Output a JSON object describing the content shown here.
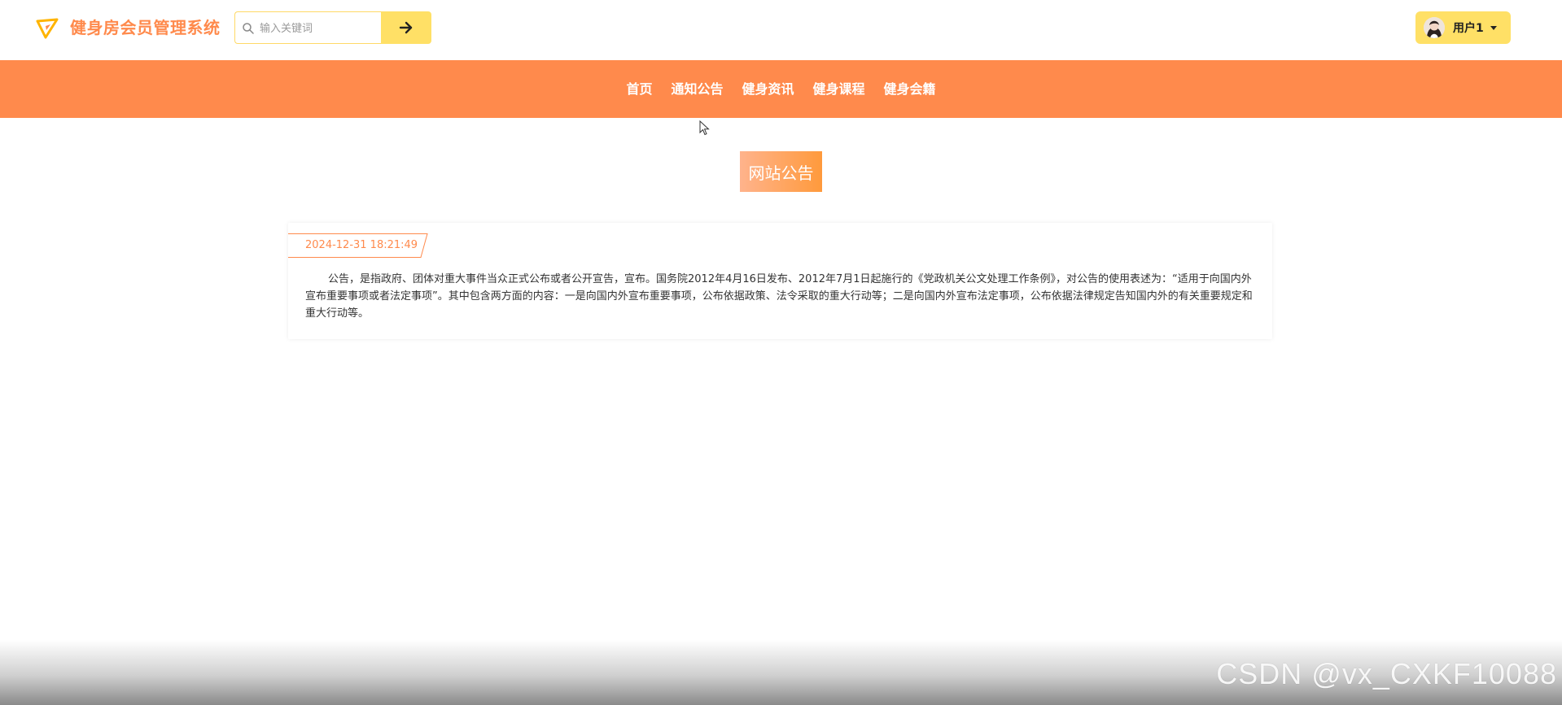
{
  "header": {
    "logo_icon": "paper-plane-icon",
    "site_title": "健身房会员管理系统",
    "search": {
      "placeholder": "输入关键词",
      "value": "",
      "search_icon": "search-icon",
      "submit_icon": "arrow-right-icon"
    },
    "user_menu": {
      "label": "用户1",
      "avatar": "user-avatar",
      "caret_icon": "caret-down-icon"
    }
  },
  "nav": {
    "items": [
      {
        "label": "首页"
      },
      {
        "label": "通知公告"
      },
      {
        "label": "健身资讯"
      },
      {
        "label": "健身课程"
      },
      {
        "label": "健身会籍"
      }
    ]
  },
  "main": {
    "section_title": "网站公告",
    "notice": {
      "date": "2024-12-31 18:21:49",
      "content": "公告，是指政府、团体对重大事件当众正式公布或者公开宣告，宣布。国务院2012年4月16日发布、2012年7月1日起施行的《党政机关公文处理工作条例》，对公告的使用表述为：“适用于向国内外宣布重要事项或者法定事项”。其中包含两方面的内容：一是向国内外宣布重要事项，公布依据政策、法令采取的重大行动等；二是向国内外宣布法定事项，公布依据法律规定告知国内外的有关重要规定和重大行动等。"
    }
  },
  "watermark": "CSDN @vx_CXKF10088",
  "colors": {
    "accent": "#ff8a4c",
    "button_yellow": "#ffe066",
    "nav_bg": "#ff8a4c"
  }
}
